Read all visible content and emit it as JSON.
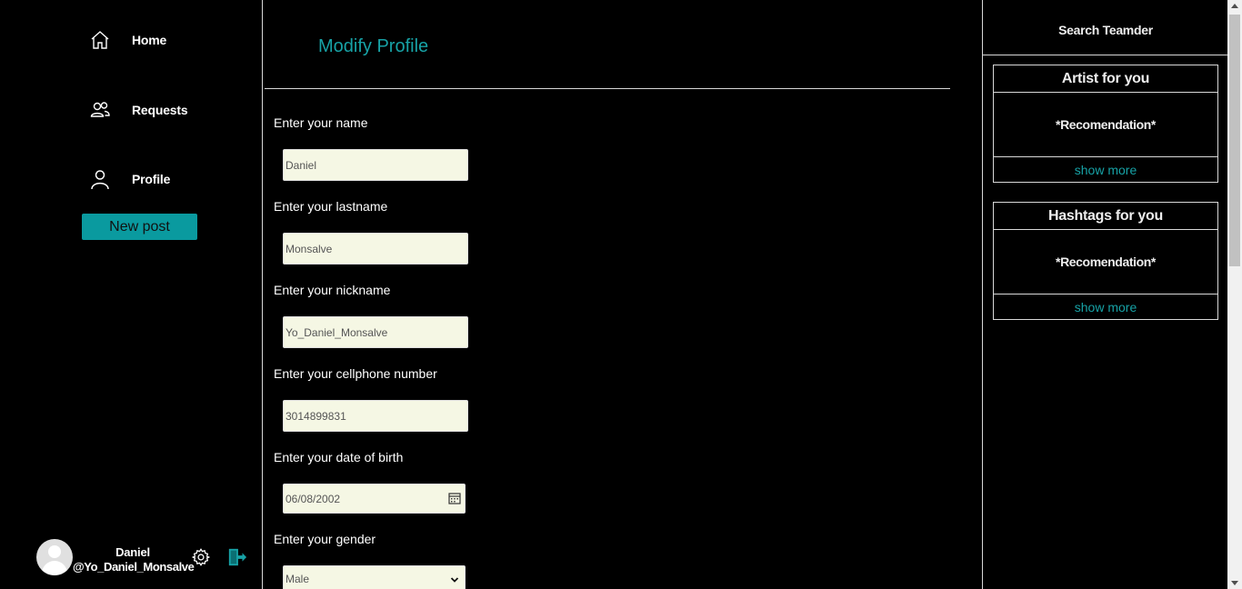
{
  "sidebar": {
    "nav": [
      {
        "label": "Home",
        "icon": "home-icon"
      },
      {
        "label": "Requests",
        "icon": "users-icon"
      },
      {
        "label": "Profile",
        "icon": "user-icon"
      }
    ],
    "new_post_label": "New post",
    "user": {
      "name": "Daniel",
      "handle": "@Yo_Daniel_Monsalve"
    }
  },
  "main": {
    "title": "Modify Profile",
    "fields": [
      {
        "label": "Enter your name",
        "value": "Daniel"
      },
      {
        "label": "Enter your lastname",
        "value": "Monsalve"
      },
      {
        "label": "Enter your nickname",
        "value": "Yo_Daniel_Monsalve"
      },
      {
        "label": "Enter your cellphone number",
        "value": "3014899831"
      },
      {
        "label": "Enter your date of birth",
        "value": "06/08/2002"
      },
      {
        "label": "Enter your gender",
        "value": "Male"
      }
    ]
  },
  "right": {
    "search_label": "Search Teamder",
    "cards": [
      {
        "title": "Artist for you",
        "body": "*Recomendation*",
        "more": "show more"
      },
      {
        "title": "Hashtags for you",
        "body": "*Recomendation*",
        "more": "show more"
      }
    ]
  },
  "colors": {
    "accent": "#17a2a6",
    "button": "#0a9a9f",
    "input_bg": "#f5f7e4",
    "background": "#000000"
  }
}
